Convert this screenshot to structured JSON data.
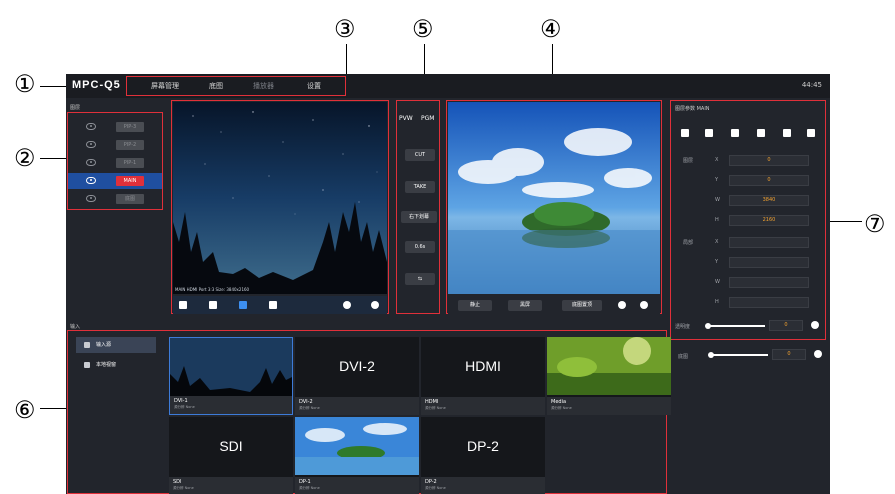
{
  "callouts": {
    "c1": "①",
    "c2": "②",
    "c3": "③",
    "c4": "④",
    "c5": "⑤",
    "c6": "⑥",
    "c7": "⑦"
  },
  "app": {
    "brand": "MPC-Q5",
    "menu": [
      "屏幕管理",
      "底图",
      "播放器",
      "设置"
    ],
    "clock": "44:45"
  },
  "layers": {
    "title": "图层",
    "items": [
      {
        "tag": "PIP-3",
        "active": false
      },
      {
        "tag": "PIP-2",
        "active": false
      },
      {
        "tag": "PIP-1",
        "active": false
      },
      {
        "tag": "MAIN",
        "active": true
      },
      {
        "tag": "底图",
        "active": false
      }
    ]
  },
  "preview": {
    "caption": "MAIN HDMI Port 3:3 Size: 3840x2160"
  },
  "transition": {
    "pvw": "PVW",
    "pgm": "PGM",
    "cut": "CUT",
    "take": "TAKE",
    "effect": "右下划幕",
    "duration": "0.6s"
  },
  "program": {
    "freeze": "静止",
    "black": "黑屏",
    "bg_top": "底图置顶"
  },
  "params": {
    "title": "图层参数 MAIN",
    "layer_label": "图层",
    "local_label": "局部",
    "x": "0",
    "y": "0",
    "w": "3840",
    "h": "2160",
    "opacity_label": "透明度",
    "opacity_value": "0",
    "bg_label": "底图",
    "bg_value": "0"
  },
  "inputs": {
    "title": "输入",
    "sidebar": [
      "输入源",
      "本地视窗"
    ],
    "tiles": [
      {
        "name": "DVI-1",
        "sub": "源分辨 None",
        "label": ""
      },
      {
        "name": "DVI-2",
        "sub": "源分辨 None",
        "label": "DVI-2"
      },
      {
        "name": "HDMI",
        "sub": "源分辨 None",
        "label": "HDMI"
      },
      {
        "name": "Media",
        "sub": "源分辨 None",
        "label": ""
      },
      {
        "name": "SDI",
        "sub": "源分辨 None",
        "label": "SDI"
      },
      {
        "name": "DP-1",
        "sub": "源分辨 None",
        "label": ""
      },
      {
        "name": "DP-2",
        "sub": "源分辨 None",
        "label": "DP-2"
      }
    ]
  }
}
